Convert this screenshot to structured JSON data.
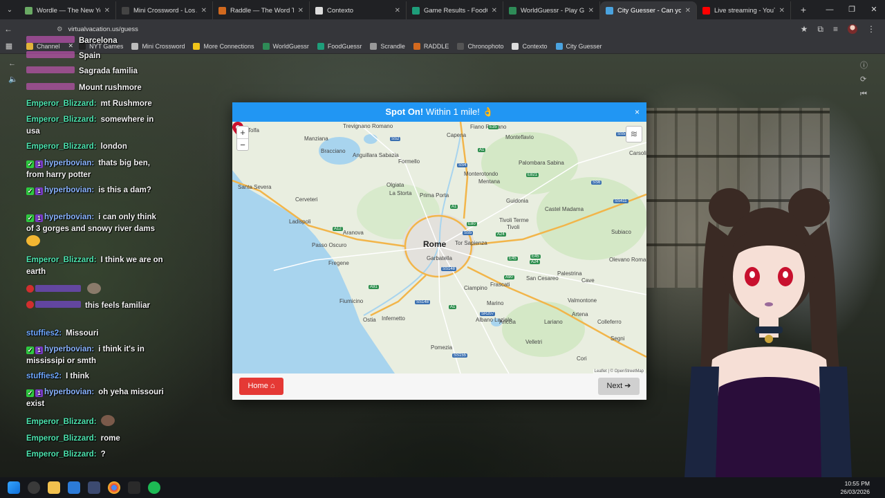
{
  "browser": {
    "tabs": [
      {
        "label": "Wordle — The New York Ti",
        "color": "#6aaa64"
      },
      {
        "label": "Mini Crossword - Los Ang",
        "color": "#444444"
      },
      {
        "label": "Raddle — The Word Trans",
        "color": "#d2691e"
      },
      {
        "label": "Contexto",
        "color": "#dddddd"
      },
      {
        "label": "Game Results - FoodGues",
        "color": "#1e9e7a"
      },
      {
        "label": "WorldGuessr - Play Geogr",
        "color": "#2e8b57"
      },
      {
        "label": "City Guesser - Can you",
        "color": "#4aa3df"
      },
      {
        "label": "Live streaming - YouTube",
        "color": "#ff0000"
      }
    ],
    "new_tab": "+",
    "url": "virtualvacation.us/guess",
    "bookmarks": [
      {
        "label": "NYT Games",
        "color": "#222222"
      },
      {
        "label": "Mini Crossword",
        "color": "#bbbbbb"
      },
      {
        "label": "More Connections",
        "color": "#f0c419"
      },
      {
        "label": "WorldGuessr",
        "color": "#2e8b57"
      },
      {
        "label": "FoodGuessr",
        "color": "#1e9e7a"
      },
      {
        "label": "Scrandle",
        "color": "#999999"
      },
      {
        "label": "RADDLE",
        "color": "#d2691e"
      },
      {
        "label": "Chronophoto",
        "color": "#555555"
      },
      {
        "label": "Contexto",
        "color": "#dddddd"
      },
      {
        "label": "City Guesser",
        "color": "#4aa3df"
      }
    ],
    "bookmark_channel": "Channel"
  },
  "chat": [
    {
      "user": "",
      "text": "Barcelona",
      "color": "#e05ad0",
      "top": 0
    },
    {
      "user": "",
      "text": "Spain",
      "color": "#e05ad0",
      "top": 0
    },
    {
      "user": "",
      "text": "Sagrada familia",
      "color": "#e05ad0",
      "top": 0
    },
    {
      "user": "",
      "text": "Mount rushmore",
      "color": "#e05ad0",
      "top": 0
    },
    {
      "user": "Emperor_Blizzard:",
      "text": "mt Rushmore",
      "color": "#4de6b0"
    },
    {
      "user": "Emperor_Blizzard:",
      "text": "somewhere in usa",
      "color": "#4de6b0"
    },
    {
      "user": "Emperor_Blizzard:",
      "text": "london",
      "color": "#4de6b0"
    },
    {
      "user": "hyperbovian:",
      "text": "thats big ben, from harry potter",
      "color": "#8ab4ff"
    },
    {
      "user": "hyperbovian:",
      "text": "is this a dam?",
      "color": "#8ab4ff"
    },
    {
      "user": "hyperbovian:",
      "text": "i can only think of 3 gorges and snowy river dams",
      "color": "#8ab4ff"
    },
    {
      "user": "Emperor_Blizzard:",
      "text": "I think we are on earth",
      "color": "#4de6b0"
    },
    {
      "user": "",
      "text": "",
      "color": "#8a4dff"
    },
    {
      "user": "",
      "text": "this feels familiar",
      "color": "#8a4dff"
    },
    {
      "user": "stuffies2:",
      "text": "Missouri",
      "color": "#6fa8ff"
    },
    {
      "user": "hyperbovian:",
      "text": "i think it's in mississipi or smth",
      "color": "#8ab4ff"
    },
    {
      "user": "stuffies2:",
      "text": "I think",
      "color": "#6fa8ff"
    },
    {
      "user": "hyperbovian:",
      "text": "oh yeha missouri exist",
      "color": "#8ab4ff"
    },
    {
      "user": "Emperor_Blizzard:",
      "text": "",
      "color": "#4de6b0"
    },
    {
      "user": "Emperor_Blizzard:",
      "text": "rome",
      "color": "#4de6b0"
    },
    {
      "user": "Emperor_Blizzard:",
      "text": "?",
      "color": "#4de6b0"
    }
  ],
  "modal": {
    "title_bold": "Spot On!",
    "title_rest": "Within 1 mile! 👌",
    "close": "×",
    "home_label": "Home",
    "next_label": "Next",
    "zoom_in": "+",
    "zoom_out": "−"
  },
  "map": {
    "main_city": "Rome",
    "places": [
      {
        "name": "Tolfa"
      },
      {
        "name": "Manziana"
      },
      {
        "name": "Trevignano Romano"
      },
      {
        "name": "Bracciano"
      },
      {
        "name": "Anguillara Sabazia"
      },
      {
        "name": "Formello"
      },
      {
        "name": "Capena"
      },
      {
        "name": "Fiano Romano"
      },
      {
        "name": "Monteflavio"
      },
      {
        "name": "Palombara Sabina"
      },
      {
        "name": "Monterotondo"
      },
      {
        "name": "Mentana"
      },
      {
        "name": "Santa Severa"
      },
      {
        "name": "Cerveteri"
      },
      {
        "name": "Olgiata"
      },
      {
        "name": "La Storta"
      },
      {
        "name": "Prima Porta"
      },
      {
        "name": "Guidonia"
      },
      {
        "name": "Castel Madama"
      },
      {
        "name": "Tivoli Terme"
      },
      {
        "name": "Tivoli"
      },
      {
        "name": "Ladispoli"
      },
      {
        "name": "Aranova"
      },
      {
        "name": "Subiaco"
      },
      {
        "name": "Passo Oscuro"
      },
      {
        "name": "Tor Sapienza"
      },
      {
        "name": "Garbatella"
      },
      {
        "name": "Fregene"
      },
      {
        "name": "Fiumicino"
      },
      {
        "name": "Ciampino"
      },
      {
        "name": "Frascati"
      },
      {
        "name": "San Cesareo"
      },
      {
        "name": "Palestrina"
      },
      {
        "name": "Cave"
      },
      {
        "name": "Olevano Romano"
      },
      {
        "name": "Marino"
      },
      {
        "name": "Valmontone"
      },
      {
        "name": "Ostia"
      },
      {
        "name": "Infernetto"
      },
      {
        "name": "Albano Laziale"
      },
      {
        "name": "Ariccia"
      },
      {
        "name": "Lariano"
      },
      {
        "name": "Artena"
      },
      {
        "name": "Colleferro"
      },
      {
        "name": "Velletri"
      },
      {
        "name": "Segni"
      },
      {
        "name": "Pomezia"
      },
      {
        "name": "Cori"
      },
      {
        "name": "Carsoli"
      }
    ],
    "roads": [
      "SS2",
      "E35",
      "A1",
      "SS4",
      "E80",
      "A24",
      "SS5",
      "E821",
      "A90",
      "E45",
      "A12",
      "A91",
      "SS148",
      "SR207",
      "A1",
      "SS155",
      "A24",
      "SS6",
      "SS411",
      "SS5",
      "E45",
      "SS148",
      "A1"
    ],
    "attribution": "Leaflet | © OpenStreetMap"
  },
  "taskbar": {
    "time": "10:55 PM",
    "date": "26/03/2026"
  }
}
